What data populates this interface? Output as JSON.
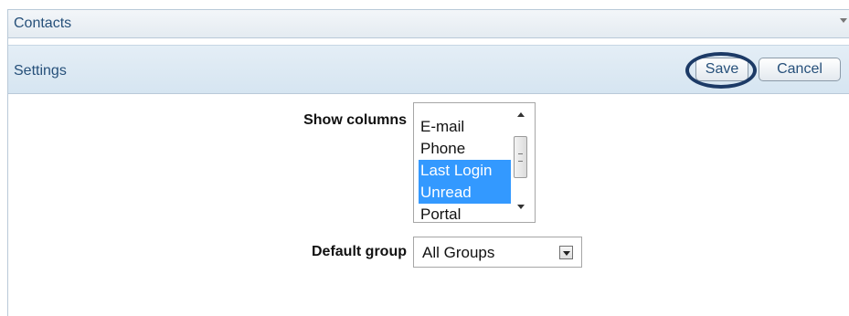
{
  "panel": {
    "title": "Contacts",
    "collapse_icon": "chevron-down-icon"
  },
  "settings": {
    "label": "Settings",
    "save_label": "Save",
    "cancel_label": "Cancel",
    "highlight_color": "#1c3a66"
  },
  "form": {
    "show_columns_label": "Show columns",
    "columns_options": [
      {
        "label": "E-mail",
        "selected": false
      },
      {
        "label": "Phone",
        "selected": false
      },
      {
        "label": "Last Login",
        "selected": true
      },
      {
        "label": "Unread",
        "selected": true
      },
      {
        "label": "Portal",
        "selected": false
      }
    ],
    "default_group_label": "Default group",
    "default_group_value": "All Groups"
  },
  "colors": {
    "header_text": "#26507a",
    "selection": "#3399ff"
  }
}
